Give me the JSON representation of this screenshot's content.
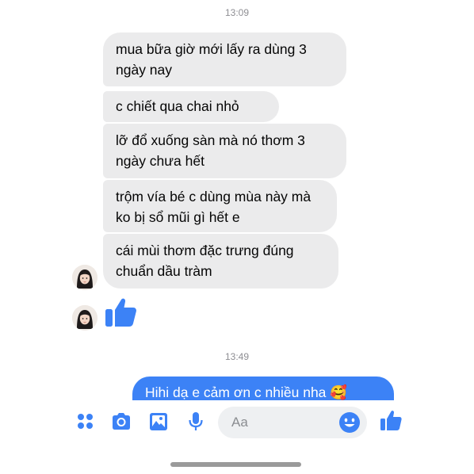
{
  "conversation": {
    "timestamps": [
      "13:09",
      "13:49"
    ],
    "incoming_messages": [
      "mua bữa giờ mới lấy ra dùng 3 ngày nay",
      "c chiết qua chai nhỏ",
      "lỡ đổ xuống sàn mà nó thơm 3 ngày chưa hết",
      "trộm vía bé c dùng mùa này mà ko bị sổ mũi gì hết e",
      "cái mùi thơm đặc trưng đúng chuẩn dầu tràm"
    ],
    "outgoing_messages": [
      "Hihi dạ e cảm ơn c nhiều nha 🥰"
    ],
    "reaction_icon": "thumbs-up-icon"
  },
  "composer": {
    "placeholder": "Aa",
    "tools": [
      "more-apps-icon",
      "camera-icon",
      "gallery-icon",
      "microphone-icon"
    ],
    "emoji_icon": "emoji-icon",
    "send_icon": "thumbs-up-icon"
  },
  "colors": {
    "accent": "#3c82f6",
    "incoming_bubble": "#ebebec",
    "timestamp": "#8e8e93"
  }
}
